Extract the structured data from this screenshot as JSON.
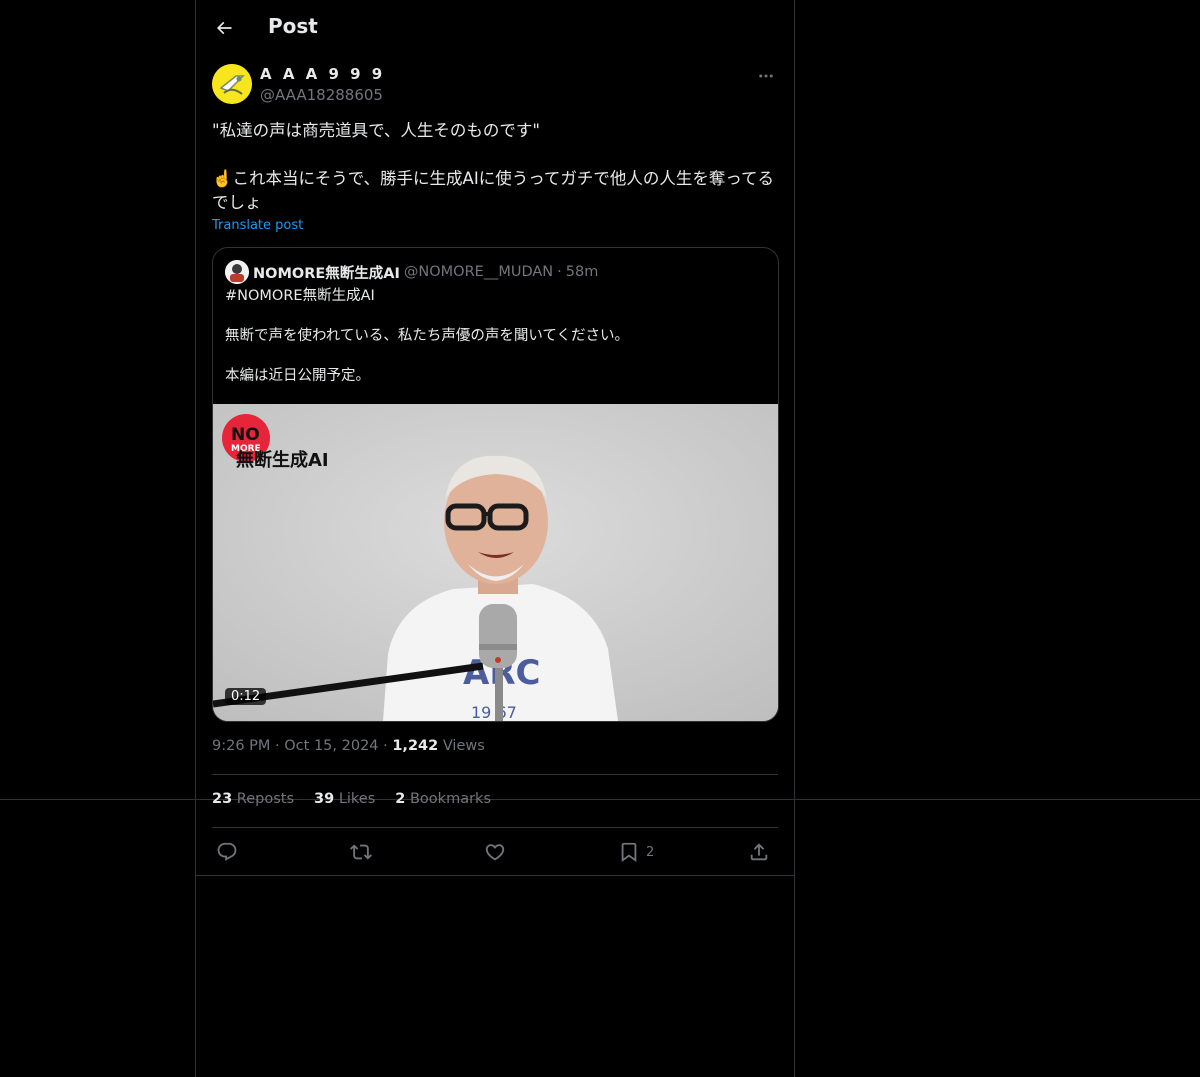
{
  "header": {
    "title": "Post"
  },
  "author": {
    "display_name": "A A A 9 9 9",
    "handle": "@AAA18288605"
  },
  "tweet": {
    "text": "\"私達の声は商売道具で、人生そのものです\"\n\n☝️これ本当にそうで、勝手に生成AIに使うってガチで他人の人生を奪ってるでしょ",
    "translate_label": "Translate post"
  },
  "quote": {
    "name": "NOMORE無断生成AI",
    "handle": "@NOMORE__MUDAN",
    "separator": "·",
    "time": "58m",
    "text": "#NOMORE無断生成AI\n\n無断で声を使われている、私たち声優の声を聞いてください。\n\n本編は近日公開予定。",
    "media": {
      "duration": "0:12",
      "logo_no": "NO",
      "logo_more": "MORE",
      "logo_text": "無断生成AI"
    }
  },
  "meta": {
    "time": "9:26 PM",
    "date": "Oct 15, 2024",
    "separator": "·",
    "views_count": "1,242",
    "views_label": "Views"
  },
  "stats": {
    "reposts": {
      "count": "23",
      "label": "Reposts"
    },
    "likes": {
      "count": "39",
      "label": "Likes"
    },
    "bookmarks": {
      "count": "2",
      "label": "Bookmarks"
    }
  },
  "actions": {
    "bookmark_count": "2"
  },
  "icons": [
    "back-arrow-icon",
    "more-icon",
    "reply-icon",
    "repost-icon",
    "like-icon",
    "bookmark-icon",
    "share-icon"
  ],
  "colors": {
    "background": "#000000",
    "text": "#e7e9ea",
    "muted": "#71767b",
    "link": "#1d9bf0",
    "border": "#2f3336"
  }
}
